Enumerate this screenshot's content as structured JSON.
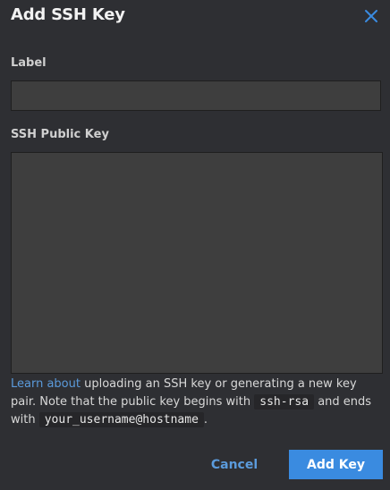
{
  "dialog": {
    "title": "Add SSH Key",
    "close_icon": "close-x-icon"
  },
  "form": {
    "label_field": {
      "label": "Label",
      "value": "",
      "placeholder": ""
    },
    "public_key_field": {
      "label": "SSH Public Key",
      "value": "",
      "placeholder": ""
    }
  },
  "help": {
    "link_text": "Learn about",
    "text_1": " uploading an SSH key or generating a new key pair. Note that the public key begins with ",
    "code_1": "ssh-rsa",
    "text_2": " and ends with ",
    "code_2": "your_username@hostname",
    "text_3": "."
  },
  "actions": {
    "cancel_label": "Cancel",
    "add_label": "Add Key"
  },
  "colors": {
    "background": "#2e2f33",
    "input_background": "#3e3e3e",
    "accent": "#3a8be0",
    "link": "#5b9bdc"
  }
}
